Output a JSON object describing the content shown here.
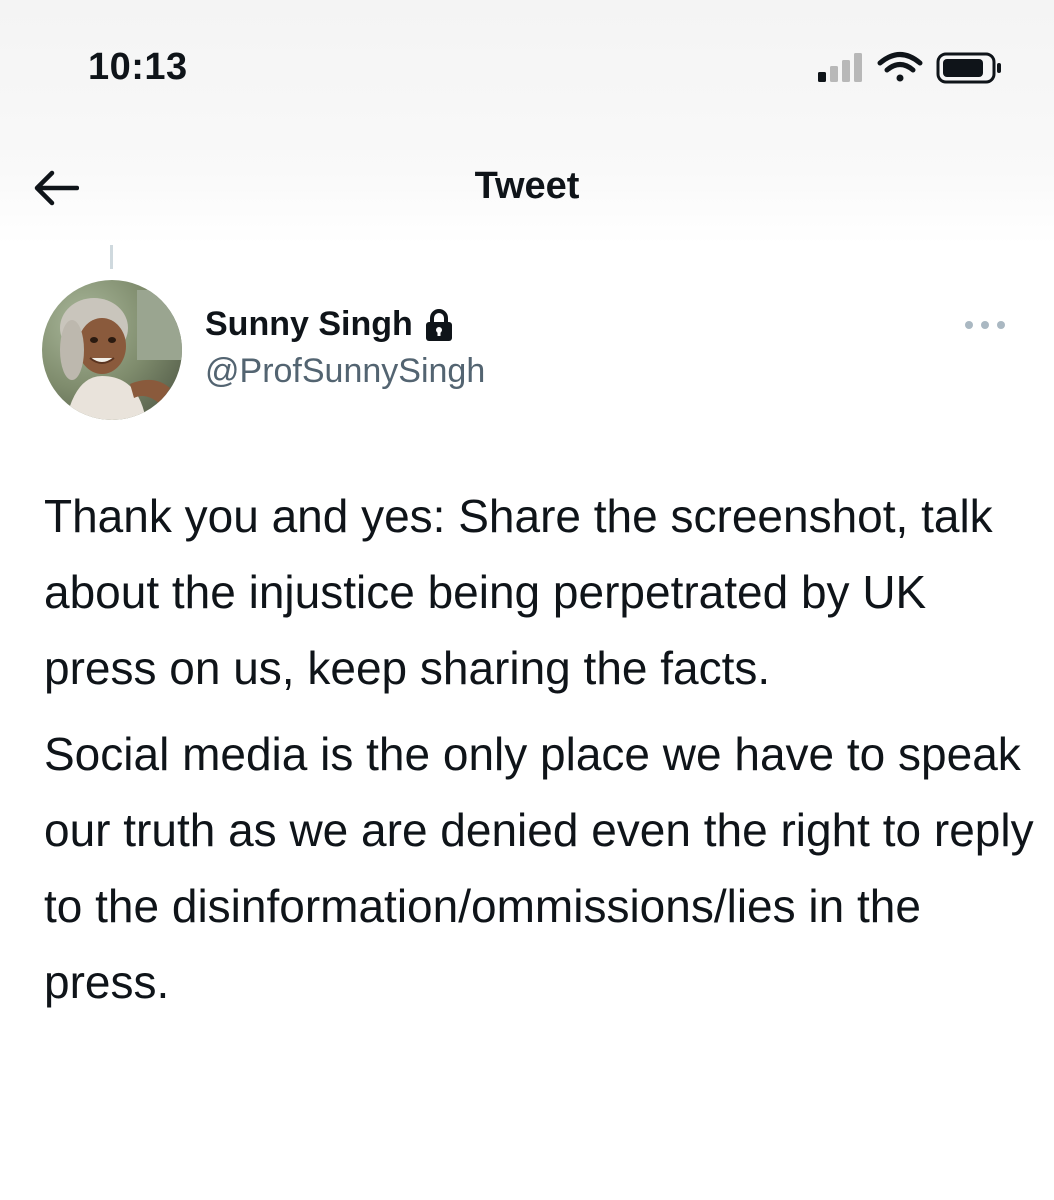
{
  "status_bar": {
    "time": "10:13",
    "icons": [
      "cellular-signal-icon",
      "wifi-icon",
      "battery-icon"
    ]
  },
  "nav": {
    "back_icon": "arrow-left-icon",
    "title": "Tweet"
  },
  "tweet": {
    "author": {
      "name": "Sunny Singh",
      "protected_icon": "lock-icon",
      "handle": "@ProfSunnySingh"
    },
    "more_icon": "more-horizontal-icon",
    "paragraphs": [
      "Thank you and yes: Share the screenshot, talk about the injustice being perpetrated by UK press on us, keep sharing the facts.",
      "Social media is the only place we have to speak our truth as we are denied even the right to reply to the disinformation/ommissions/lies in the press."
    ]
  },
  "colors": {
    "text_primary": "#0f1419",
    "text_secondary": "#536471",
    "thread_line": "#cfd9de",
    "header_bg": "#f4f4f4"
  }
}
